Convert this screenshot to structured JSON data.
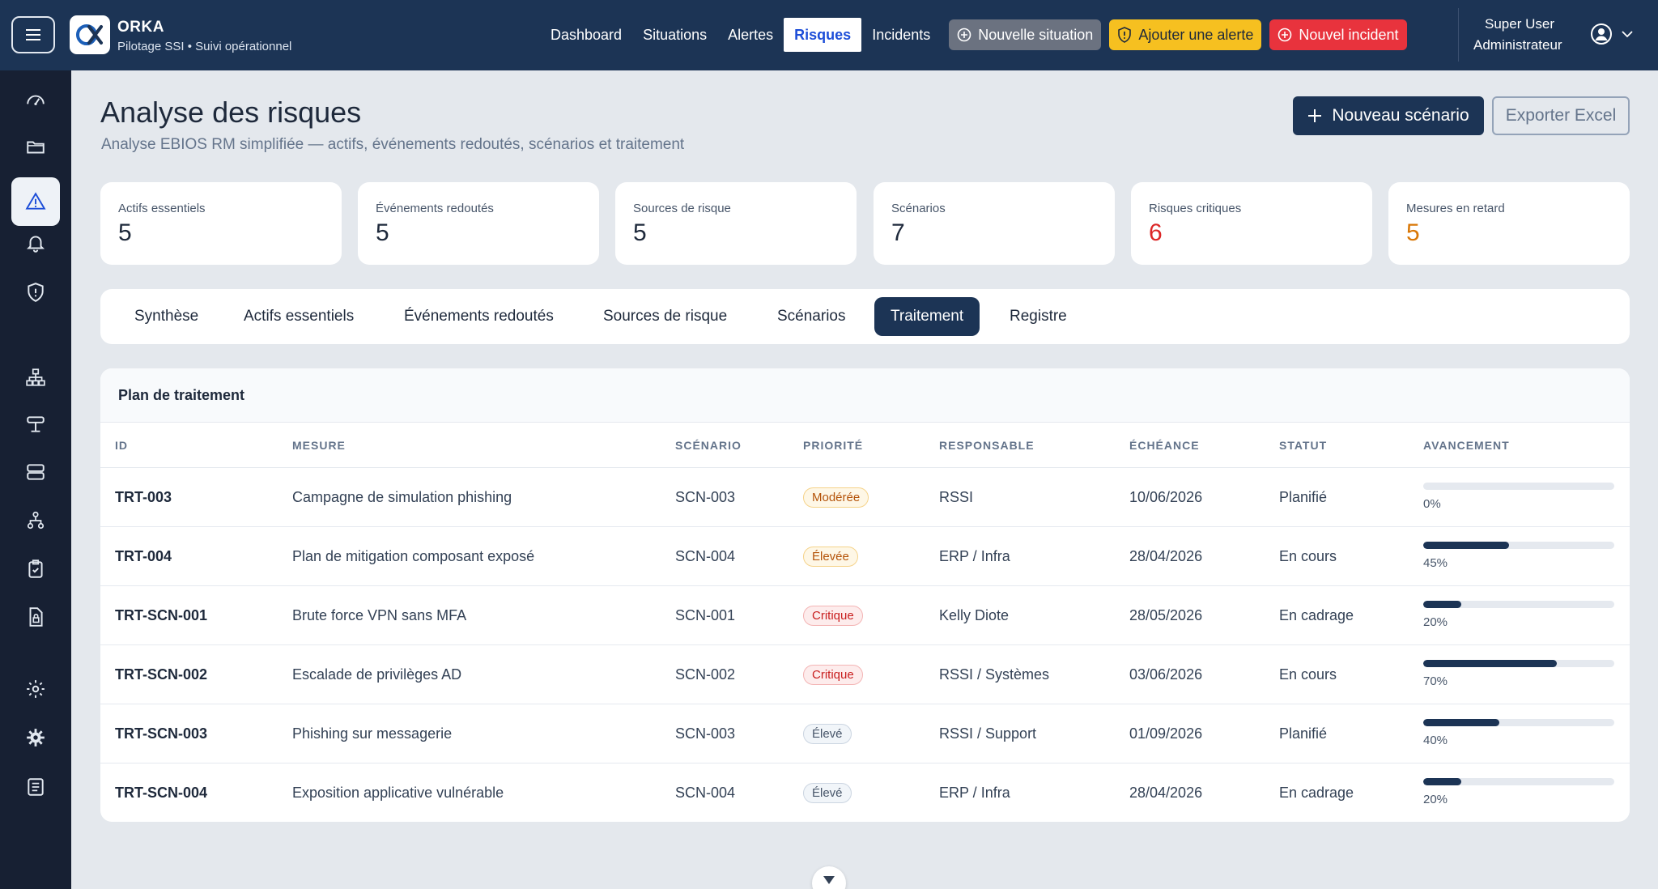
{
  "app": {
    "name": "ORKA",
    "tagline": "Pilotage SSI • Suivi opérationnel"
  },
  "nav": [
    {
      "label": "Dashboard"
    },
    {
      "label": "Situations"
    },
    {
      "label": "Alertes"
    },
    {
      "label": "Risques",
      "active": true
    },
    {
      "label": "Incidents"
    }
  ],
  "actions": {
    "new_situation": "Nouvelle situation",
    "add_alert": "Ajouter une alerte",
    "new_incident": "Nouvel incident"
  },
  "user": {
    "name": "Super User",
    "role": "Administrateur"
  },
  "sidebar": {
    "items": [
      {
        "icon": "dashboard-gauge-icon"
      },
      {
        "icon": "folder-icon"
      },
      {
        "icon": "warning-triangle-icon",
        "active": true
      },
      {
        "icon": "bell-icon"
      },
      {
        "icon": "shield-icon"
      },
      {
        "icon": "network-icon"
      },
      {
        "icon": "router-icon"
      },
      {
        "icon": "server-icon"
      },
      {
        "icon": "hierarchy-icon"
      },
      {
        "icon": "clipboard-check-icon"
      },
      {
        "icon": "locked-file-icon"
      },
      {
        "icon": "settings-outline-icon"
      },
      {
        "icon": "settings-filled-icon"
      },
      {
        "icon": "log-list-icon"
      }
    ]
  },
  "page": {
    "title": "Analyse des risques",
    "subtitle": "Analyse EBIOS RM simplifiée — actifs, événements redoutés, scénarios et traitement",
    "new_scenario": "Nouveau scénario",
    "export": "Exporter Excel"
  },
  "stats": [
    {
      "label": "Actifs essentiels",
      "value": "5",
      "color": "#1e293b"
    },
    {
      "label": "Événements redoutés",
      "value": "5",
      "color": "#1e293b"
    },
    {
      "label": "Sources de risque",
      "value": "5",
      "color": "#1e293b"
    },
    {
      "label": "Scénarios",
      "value": "7",
      "color": "#1e293b"
    },
    {
      "label": "Risques critiques",
      "value": "6",
      "color": "#dc2626"
    },
    {
      "label": "Mesures en retard",
      "value": "5",
      "color": "#d97706"
    }
  ],
  "tabs": [
    {
      "label": "Synthèse"
    },
    {
      "label": "Actifs essentiels"
    },
    {
      "label": "Événements redoutés"
    },
    {
      "label": "Sources de risque"
    },
    {
      "label": "Scénarios"
    },
    {
      "label": "Traitement",
      "active": true
    },
    {
      "label": "Registre"
    }
  ],
  "table": {
    "title": "Plan de traitement",
    "headers": {
      "id": "ID",
      "mesure": "MESURE",
      "scenario": "SCÉNARIO",
      "priorite": "PRIORITÉ",
      "responsable": "RESPONSABLE",
      "echeance": "ÉCHÉANCE",
      "statut": "STATUT",
      "avancement": "AVANCEMENT"
    },
    "rows": [
      {
        "id": "TRT-003",
        "mesure": "Campagne de simulation phishing",
        "scenario": "SCN-003",
        "priorite": "Modérée",
        "priority_level": "moderate",
        "responsable": "RSSI",
        "echeance": "10/06/2026",
        "statut": "Planifié",
        "progress": 0,
        "progress_label": "0%"
      },
      {
        "id": "TRT-004",
        "mesure": "Plan de mitigation composant exposé",
        "scenario": "SCN-004",
        "priorite": "Élevée",
        "priority_level": "moderate",
        "responsable": "ERP / Infra",
        "echeance": "28/04/2026",
        "statut": "En cours",
        "progress": 45,
        "progress_label": "45%"
      },
      {
        "id": "TRT-SCN-001",
        "mesure": "Brute force VPN sans MFA",
        "scenario": "SCN-001",
        "priorite": "Critique",
        "priority_level": "critical",
        "responsable": "Kelly Diote",
        "echeance": "28/05/2026",
        "statut": "En cadrage",
        "progress": 20,
        "progress_label": "20%"
      },
      {
        "id": "TRT-SCN-002",
        "mesure": "Escalade de privilèges AD",
        "scenario": "SCN-002",
        "priorite": "Critique",
        "priority_level": "critical",
        "responsable": "RSSI / Systèmes",
        "echeance": "03/06/2026",
        "statut": "En cours",
        "progress": 70,
        "progress_label": "70%"
      },
      {
        "id": "TRT-SCN-003",
        "mesure": "Phishing sur messagerie",
        "scenario": "SCN-003",
        "priorite": "Élevé",
        "priority_level": "neutral",
        "responsable": "RSSI / Support",
        "echeance": "01/09/2026",
        "statut": "Planifié",
        "progress": 40,
        "progress_label": "40%"
      },
      {
        "id": "TRT-SCN-004",
        "mesure": "Exposition applicative vulnérable",
        "scenario": "SCN-004",
        "priorite": "Élevé",
        "priority_level": "neutral",
        "responsable": "ERP / Infra",
        "echeance": "28/04/2026",
        "statut": "En cadrage",
        "progress": 20,
        "progress_label": "20%"
      }
    ]
  },
  "colors": {
    "navy": "#1c3455",
    "sidebar": "#172033",
    "yellow": "#f6c020",
    "red": "#e8333d",
    "critical_text": "#dc2626",
    "late_text": "#d97706"
  }
}
